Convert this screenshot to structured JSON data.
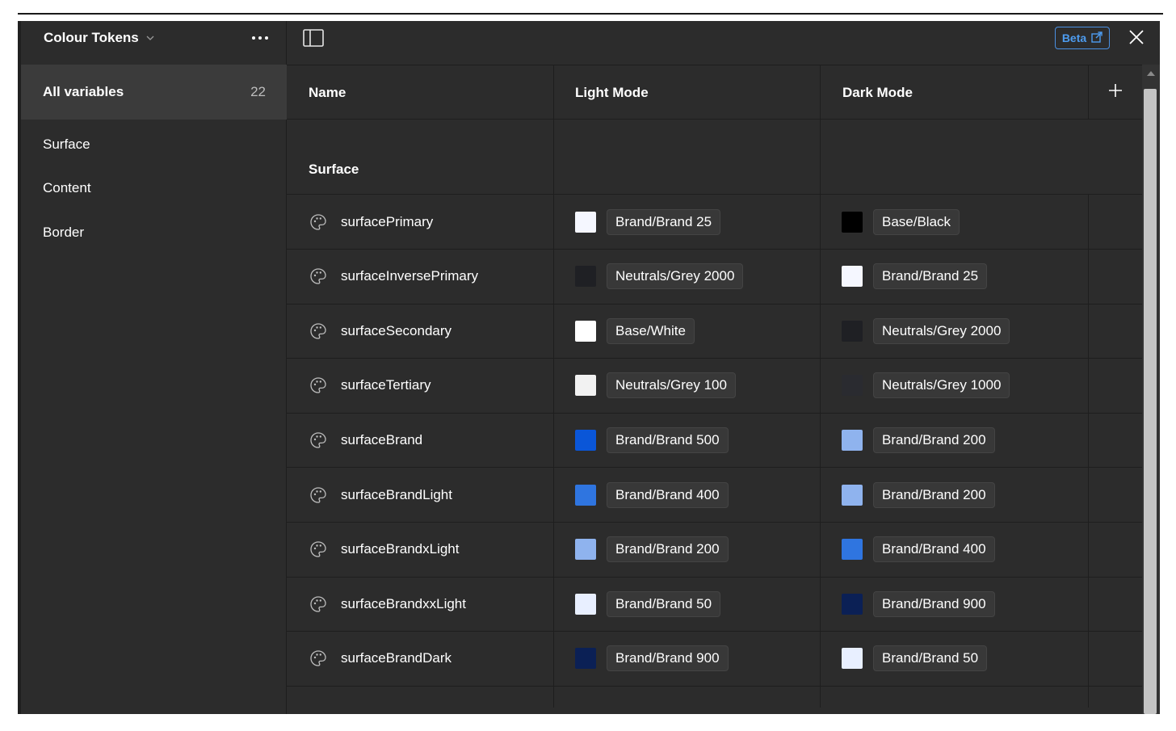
{
  "sidebar": {
    "collection_title": "Colour Tokens",
    "all_variables": {
      "label": "All variables",
      "count": "22"
    },
    "groups": [
      {
        "label": "Surface"
      },
      {
        "label": "Content"
      },
      {
        "label": "Border"
      }
    ]
  },
  "toolbar": {
    "beta_label": "Beta"
  },
  "table": {
    "headers": {
      "name": "Name",
      "light": "Light Mode",
      "dark": "Dark Mode"
    },
    "group_label": "Surface",
    "rows": [
      {
        "name": "surfacePrimary",
        "light": {
          "value": "Brand/Brand 25",
          "color": "#f5f7ff"
        },
        "dark": {
          "value": "Base/Black",
          "color": "#000000"
        }
      },
      {
        "name": "surfaceInversePrimary",
        "light": {
          "value": "Neutrals/Grey 2000",
          "color": "#1f2024"
        },
        "dark": {
          "value": "Brand/Brand 25",
          "color": "#f5f7ff"
        }
      },
      {
        "name": "surfaceSecondary",
        "light": {
          "value": "Base/White",
          "color": "#ffffff"
        },
        "dark": {
          "value": "Neutrals/Grey 2000",
          "color": "#1f2024"
        }
      },
      {
        "name": "surfaceTertiary",
        "light": {
          "value": "Neutrals/Grey 100",
          "color": "#f2f2f2"
        },
        "dark": {
          "value": "Neutrals/Grey 1000",
          "color": "#2a2b30"
        }
      },
      {
        "name": "surfaceBrand",
        "light": {
          "value": "Brand/Brand 500",
          "color": "#0a56d8"
        },
        "dark": {
          "value": "Brand/Brand 200",
          "color": "#8fb3ee"
        }
      },
      {
        "name": "surfaceBrandLight",
        "light": {
          "value": "Brand/Brand 400",
          "color": "#2f75e0"
        },
        "dark": {
          "value": "Brand/Brand 200",
          "color": "#8fb3ee"
        }
      },
      {
        "name": "surfaceBrandxLight",
        "light": {
          "value": "Brand/Brand 200",
          "color": "#8fb3ee"
        },
        "dark": {
          "value": "Brand/Brand 400",
          "color": "#2f75e0"
        }
      },
      {
        "name": "surfaceBrandxxLight",
        "light": {
          "value": "Brand/Brand 50",
          "color": "#e8efff"
        },
        "dark": {
          "value": "Brand/Brand 900",
          "color": "#0b2055"
        }
      },
      {
        "name": "surfaceBrandDark",
        "light": {
          "value": "Brand/Brand 900",
          "color": "#0b2055"
        },
        "dark": {
          "value": "Brand/Brand 50",
          "color": "#e8efff"
        }
      }
    ]
  },
  "icons": {
    "panel": "sidebar-toggle-icon",
    "close": "close-icon",
    "add": "plus-icon",
    "variable": "palette-icon",
    "external": "external-link-icon",
    "chevron": "chevron-down-icon",
    "more": "more-icon"
  },
  "colors": {
    "background": "#2c2c2c",
    "selected": "#3b3b3b",
    "accent": "#4a90e2"
  }
}
